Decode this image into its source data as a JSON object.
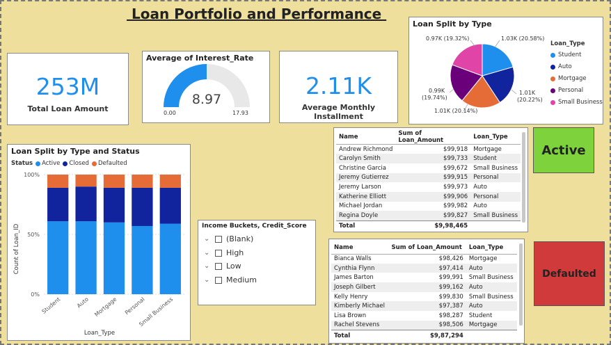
{
  "report": {
    "title": " Loan Portfolio and Performance "
  },
  "kpis": {
    "total_loan_amount": {
      "value": "253M",
      "label": "Total Loan Amount"
    },
    "avg_installment": {
      "value": "2.11K",
      "label": "Average Monthly Installment"
    }
  },
  "gauge": {
    "title": "Average of Interest_Rate",
    "value": "8.97",
    "min_label": "0.00",
    "max_label": "17.93",
    "fill_fraction": 0.5,
    "fill_color": "#1f8fee",
    "track_color": "#e8e8e8"
  },
  "pie": {
    "title": "Loan Split by Type",
    "legend_title": "Loan_Type",
    "slice_labels": {
      "student": "1.03K (20.58%)",
      "auto_1": "1.01K",
      "auto_2": "(20.22%)",
      "mortgage": "1.01K (20.14%)",
      "personal_1": "0.99K",
      "personal_2": "(19.74%)",
      "small_business": "0.97K (19.32%)"
    }
  },
  "colors": {
    "Student": "#1f8fee",
    "Auto": "#12239e",
    "Mortgage": "#e66c37",
    "Personal": "#6b007b",
    "Small Business": "#e044a7",
    "Active": "#1f8fee",
    "Closed": "#12239e",
    "Defaulted": "#e66c37",
    "active_box": "#7ed23c",
    "defaulted_box": "#d13a3a"
  },
  "chart_data": [
    {
      "type": "pie",
      "title": "Loan Split by Type",
      "legend_title": "Loan_Type",
      "categories": [
        "Student",
        "Auto",
        "Mortgage",
        "Personal",
        "Small Business"
      ],
      "values": [
        1030,
        1010,
        1010,
        990,
        970
      ],
      "percents": [
        20.58,
        20.22,
        20.14,
        19.74,
        19.32
      ]
    },
    {
      "type": "bar",
      "stacked": "100%",
      "title": "Loan Split by Type and Status",
      "legend_title": "Status",
      "xlabel": "Loan_Type",
      "ylabel": "Count of Loan_ID",
      "y_ticks": [
        "0%",
        "50%",
        "100%"
      ],
      "categories": [
        "Student",
        "Auto",
        "Mortgage",
        "Personal",
        "Small Business"
      ],
      "series": [
        {
          "name": "Active",
          "values": [
            61,
            61,
            60,
            57,
            59
          ]
        },
        {
          "name": "Closed",
          "values": [
            28,
            29,
            29,
            32,
            30
          ]
        },
        {
          "name": "Defaulted",
          "values": [
            11,
            10,
            11,
            11,
            11
          ]
        }
      ]
    }
  ],
  "slicer": {
    "title": "Income Buckets, Credit_Score",
    "items": [
      "(Blank)",
      "High",
      "Low",
      "Medium"
    ]
  },
  "active_table": {
    "headers": [
      "Name",
      "Sum of Loan_Amount",
      "Loan_Type"
    ],
    "rows": [
      [
        "Andrew Richmond",
        "$99,918",
        "Mortgage"
      ],
      [
        "Carolyn Smith",
        "$99,733",
        "Student"
      ],
      [
        "Christine Garcia",
        "$99,672",
        "Small Business"
      ],
      [
        "Jeremy Gutierrez",
        "$99,915",
        "Personal"
      ],
      [
        "Jeremy Larson",
        "$99,973",
        "Auto"
      ],
      [
        "Katherine Elliott",
        "$99,906",
        "Personal"
      ],
      [
        "Michael Jordan",
        "$99,982",
        "Auto"
      ],
      [
        "Regina Doyle",
        "$99,827",
        "Small Business"
      ]
    ],
    "total_label": "Total",
    "total_value": "$9,98,465"
  },
  "defaulted_table": {
    "headers": [
      "Name",
      "Sum of Loan_Amount",
      "Loan_Type"
    ],
    "rows": [
      [
        "Bianca Walls",
        "$98,426",
        "Mortgage"
      ],
      [
        "Cynthia Flynn",
        "$97,414",
        "Auto"
      ],
      [
        "James Barton",
        "$99,991",
        "Small Business"
      ],
      [
        "Joseph Gilbert",
        "$99,162",
        "Auto"
      ],
      [
        "Kelly Henry",
        "$99,830",
        "Small Business"
      ],
      [
        "Kimberly Michael",
        "$97,387",
        "Auto"
      ],
      [
        "Lisa Brown",
        "$98,287",
        "Student"
      ],
      [
        "Rachel Stevens",
        "$98,506",
        "Mortgage"
      ]
    ],
    "total_label": "Total",
    "total_value": "$9,87,294"
  },
  "status_boxes": {
    "active": "Active",
    "defaulted": "Defaulted"
  },
  "icons": [
    "chevron-down-icon",
    "checkbox-icon"
  ]
}
